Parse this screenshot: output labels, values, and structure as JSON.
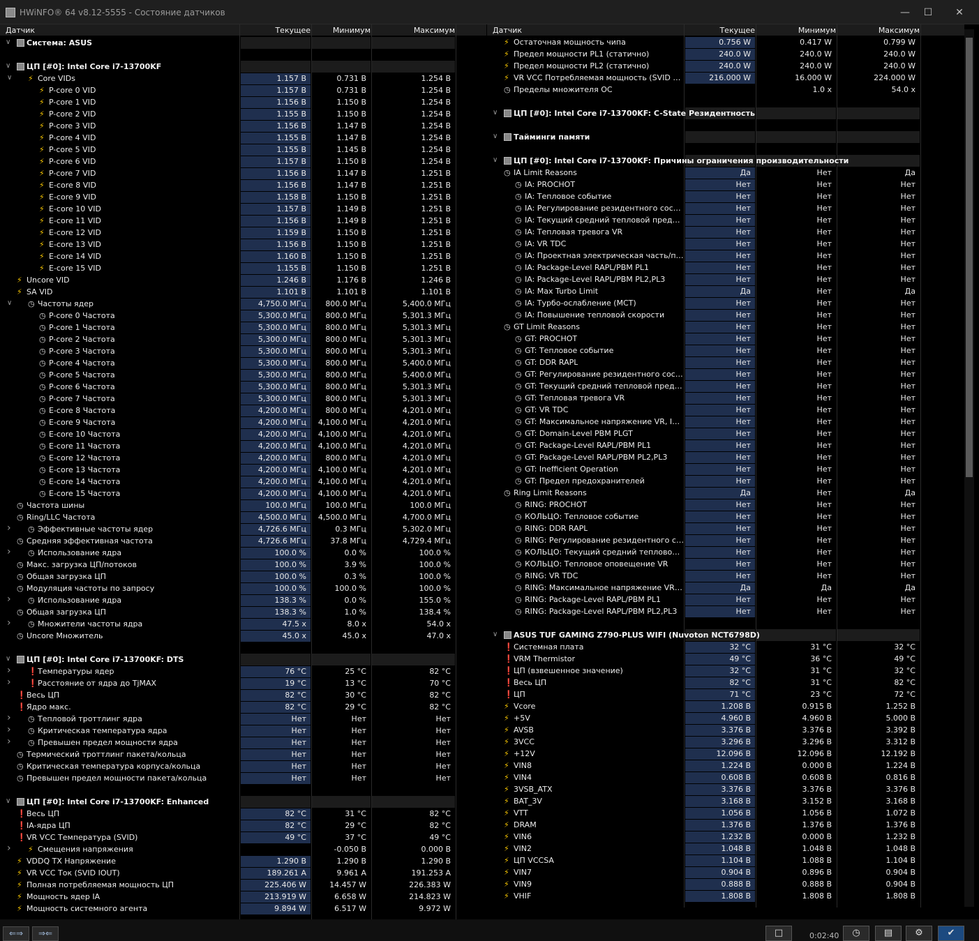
{
  "window": {
    "title": "HWiNFO® 64 v8.12-5555 - Состояние датчиков"
  },
  "columns": {
    "sensor": "Датчик",
    "current": "Текущее",
    "min": "Минимум",
    "max": "Максимум"
  },
  "statusbar": {
    "time": "0:02:40"
  },
  "left_rows": [
    [
      "s",
      "chip",
      "Система: ASUS",
      "",
      "",
      ""
    ],
    [
      "g",
      "",
      ""
    ],
    [
      "s",
      "chip",
      "ЦП [#0]: Intel Core i7-13700KF",
      "",
      "",
      ""
    ],
    [
      1,
      "bolt",
      "Core VIDs",
      "1.157 В",
      "0.731 В",
      "1.254 В",
      "e"
    ],
    [
      2,
      "bolt",
      "P-core 0 VID",
      "1.157 В",
      "0.731 В",
      "1.254 В"
    ],
    [
      2,
      "bolt",
      "P-core 1 VID",
      "1.156 В",
      "1.150 В",
      "1.254 В"
    ],
    [
      2,
      "bolt",
      "P-core 2 VID",
      "1.155 В",
      "1.150 В",
      "1.254 В"
    ],
    [
      2,
      "bolt",
      "P-core 3 VID",
      "1.156 В",
      "1.147 В",
      "1.254 В"
    ],
    [
      2,
      "bolt",
      "P-core 4 VID",
      "1.155 В",
      "1.147 В",
      "1.254 В"
    ],
    [
      2,
      "bolt",
      "P-core 5 VID",
      "1.155 В",
      "1.145 В",
      "1.254 В"
    ],
    [
      2,
      "bolt",
      "P-core 6 VID",
      "1.157 В",
      "1.150 В",
      "1.254 В"
    ],
    [
      2,
      "bolt",
      "P-core 7 VID",
      "1.156 В",
      "1.147 В",
      "1.251 В"
    ],
    [
      2,
      "bolt",
      "E-core 8 VID",
      "1.156 В",
      "1.147 В",
      "1.251 В"
    ],
    [
      2,
      "bolt",
      "E-core 9 VID",
      "1.158 В",
      "1.150 В",
      "1.251 В"
    ],
    [
      2,
      "bolt",
      "E-core 10 VID",
      "1.157 В",
      "1.149 В",
      "1.251 В"
    ],
    [
      2,
      "bolt",
      "E-core 11 VID",
      "1.156 В",
      "1.149 В",
      "1.251 В"
    ],
    [
      2,
      "bolt",
      "E-core 12 VID",
      "1.159 В",
      "1.150 В",
      "1.251 В"
    ],
    [
      2,
      "bolt",
      "E-core 13 VID",
      "1.156 В",
      "1.150 В",
      "1.251 В"
    ],
    [
      2,
      "bolt",
      "E-core 14 VID",
      "1.160 В",
      "1.150 В",
      "1.251 В"
    ],
    [
      2,
      "bolt",
      "E-core 15 VID",
      "1.155 В",
      "1.150 В",
      "1.251 В"
    ],
    [
      0,
      "bolt",
      "Uncore VID",
      "1.246 В",
      "1.176 В",
      "1.246 В"
    ],
    [
      0,
      "bolt",
      "SA VID",
      "1.101 В",
      "1.101 В",
      "1.101 В"
    ],
    [
      1,
      "clock",
      "Частоты ядер",
      "4,750.0 МГц",
      "800.0 МГц",
      "5,400.0 МГц",
      "e"
    ],
    [
      2,
      "clock",
      "P-core 0 Частота",
      "5,300.0 МГц",
      "800.0 МГц",
      "5,301.3 МГц"
    ],
    [
      2,
      "clock",
      "P-core 1 Частота",
      "5,300.0 МГц",
      "800.0 МГц",
      "5,301.3 МГц"
    ],
    [
      2,
      "clock",
      "P-core 2 Частота",
      "5,300.0 МГц",
      "800.0 МГц",
      "5,301.3 МГц"
    ],
    [
      2,
      "clock",
      "P-core 3 Частота",
      "5,300.0 МГц",
      "800.0 МГц",
      "5,301.3 МГц"
    ],
    [
      2,
      "clock",
      "P-core 4 Частота",
      "5,300.0 МГц",
      "800.0 МГц",
      "5,400.0 МГц"
    ],
    [
      2,
      "clock",
      "P-core 5 Частота",
      "5,300.0 МГц",
      "800.0 МГц",
      "5,400.0 МГц"
    ],
    [
      2,
      "clock",
      "P-core 6 Частота",
      "5,300.0 МГц",
      "800.0 МГц",
      "5,301.3 МГц"
    ],
    [
      2,
      "clock",
      "P-core 7 Частота",
      "5,300.0 МГц",
      "800.0 МГц",
      "5,301.3 МГц"
    ],
    [
      2,
      "clock",
      "E-core 8 Частота",
      "4,200.0 МГц",
      "800.0 МГц",
      "4,201.0 МГц"
    ],
    [
      2,
      "clock",
      "E-core 9 Частота",
      "4,200.0 МГц",
      "4,100.0 МГц",
      "4,201.0 МГц"
    ],
    [
      2,
      "clock",
      "E-core 10 Частота",
      "4,200.0 МГц",
      "4,100.0 МГц",
      "4,201.0 МГц"
    ],
    [
      2,
      "clock",
      "E-core 11 Частота",
      "4,200.0 МГц",
      "4,100.0 МГц",
      "4,201.0 МГц"
    ],
    [
      2,
      "clock",
      "E-core 12 Частота",
      "4,200.0 МГц",
      "800.0 МГц",
      "4,201.0 МГц"
    ],
    [
      2,
      "clock",
      "E-core 13 Частота",
      "4,200.0 МГц",
      "4,100.0 МГц",
      "4,201.0 МГц"
    ],
    [
      2,
      "clock",
      "E-core 14 Частота",
      "4,200.0 МГц",
      "4,100.0 МГц",
      "4,201.0 МГц"
    ],
    [
      2,
      "clock",
      "E-core 15 Частота",
      "4,200.0 МГц",
      "4,100.0 МГц",
      "4,201.0 МГц"
    ],
    [
      0,
      "clock",
      "Частота шины",
      "100.0 МГц",
      "100.0 МГц",
      "100.0 МГц"
    ],
    [
      0,
      "clock",
      "Ring/LLC Частота",
      "4,500.0 МГц",
      "4,500.0 МГц",
      "4,700.0 МГц"
    ],
    [
      1,
      "clock",
      "Эффективные частоты ядер",
      "4,726.6 МГц",
      "0.3 МГц",
      "5,302.0 МГц",
      "c"
    ],
    [
      0,
      "clock",
      "Средняя эффективная частота",
      "4,726.6 МГц",
      "37.8 МГц",
      "4,729.4 МГц"
    ],
    [
      1,
      "clock",
      "Использование ядра",
      "100.0 %",
      "0.0 %",
      "100.0 %",
      "c"
    ],
    [
      0,
      "clock",
      "Макс. загрузка ЦП/потоков",
      "100.0 %",
      "3.9 %",
      "100.0 %"
    ],
    [
      0,
      "clock",
      "Общая загрузка ЦП",
      "100.0 %",
      "0.3 %",
      "100.0 %"
    ],
    [
      0,
      "clock",
      "Модуляция частоты по запросу",
      "100.0 %",
      "100.0 %",
      "100.0 %"
    ],
    [
      1,
      "clock",
      "Использование ядра",
      "138.3 %",
      "0.0 %",
      "155.0 %",
      "c"
    ],
    [
      0,
      "clock",
      "Общая загрузка ЦП",
      "138.3 %",
      "1.0 %",
      "138.4 %"
    ],
    [
      1,
      "clock",
      "Множители частоты ядра",
      "47.5 x",
      "8.0 x",
      "54.0 x",
      "c"
    ],
    [
      0,
      "clock",
      "Uncore Множитель",
      "45.0 x",
      "45.0 x",
      "47.0 x"
    ],
    [
      "g",
      "",
      ""
    ],
    [
      "s",
      "chip",
      "ЦП [#0]: Intel Core i7-13700KF: DTS",
      "",
      "",
      ""
    ],
    [
      1,
      "therm",
      "Температуры ядер",
      "76 °C",
      "25 °C",
      "82 °C",
      "c"
    ],
    [
      1,
      "therm",
      "Расстояние от ядра до TjMAX",
      "19 °C",
      "13 °C",
      "70 °C",
      "c"
    ],
    [
      0,
      "therm",
      "Весь ЦП",
      "82 °C",
      "30 °C",
      "82 °C"
    ],
    [
      0,
      "therm",
      "Ядро макс.",
      "82 °C",
      "29 °C",
      "82 °C"
    ],
    [
      1,
      "clock",
      "Тепловой троттлинг ядра",
      "Нет",
      "Нет",
      "Нет",
      "c"
    ],
    [
      1,
      "clock",
      "Критическая температура ядра",
      "Нет",
      "Нет",
      "Нет",
      "c"
    ],
    [
      1,
      "clock",
      "Превышен предел мощности ядра",
      "Нет",
      "Нет",
      "Нет",
      "c"
    ],
    [
      0,
      "clock",
      "Термический троттлинг пакета/кольца",
      "Нет",
      "Нет",
      "Нет"
    ],
    [
      0,
      "clock",
      "Критическая температура корпуса/кольца",
      "Нет",
      "Нет",
      "Нет"
    ],
    [
      0,
      "clock",
      "Превышен предел мощности пакета/кольца",
      "Нет",
      "Нет",
      "Нет"
    ],
    [
      "g",
      "",
      ""
    ],
    [
      "s",
      "chip",
      "ЦП [#0]: Intel Core i7-13700KF: Enhanced",
      "",
      "",
      ""
    ],
    [
      0,
      "therm",
      "Весь ЦП",
      "82 °C",
      "31 °C",
      "82 °C"
    ],
    [
      0,
      "therm",
      "IA-ядра ЦП",
      "82 °C",
      "29 °C",
      "82 °C"
    ],
    [
      0,
      "therm",
      "VR VCC Температура (SVID)",
      "49 °C",
      "37 °C",
      "49 °C"
    ],
    [
      1,
      "bolt",
      "Смещения напряжения",
      "",
      "-0.050 В",
      "0.000 В",
      "c"
    ],
    [
      0,
      "bolt",
      "VDDQ TX Напряжение",
      "1.290 В",
      "1.290 В",
      "1.290 В"
    ],
    [
      0,
      "bolt",
      "VR VCC Ток (SVID IOUT)",
      "189.261 A",
      "9.961 A",
      "191.253 A"
    ],
    [
      0,
      "bolt",
      "Полная потребляемая мощность ЦП",
      "225.406 W",
      "14.457 W",
      "226.383 W"
    ],
    [
      0,
      "bolt",
      "Мощность ядер IA",
      "213.919 W",
      "6.658 W",
      "214.823 W"
    ],
    [
      0,
      "bolt",
      "Мощность системного агента",
      "9.894 W",
      "6.517 W",
      "9.972 W"
    ]
  ],
  "right_rows": [
    [
      0,
      "bolt",
      "Остаточная мощность чипа",
      "0.756 W",
      "0.417 W",
      "0.799 W"
    ],
    [
      0,
      "bolt",
      "Предел мощности PL1 (статично)",
      "240.0 W",
      "240.0 W",
      "240.0 W"
    ],
    [
      0,
      "bolt",
      "Предел мощности PL2 (статично)",
      "240.0 W",
      "240.0 W",
      "240.0 W"
    ],
    [
      0,
      "bolt",
      "VR VCC Потребляемая мощность (SVID POUT)",
      "216.000 W",
      "16.000 W",
      "224.000 W"
    ],
    [
      0,
      "clock",
      "Пределы множителя ОС",
      "",
      "1.0 x",
      "54.0 x",
      "c"
    ],
    [
      "g",
      "",
      ""
    ],
    [
      "s",
      "chip",
      "ЦП [#0]: Intel Core i7-13700KF: C-State Резидентность",
      "",
      "",
      ""
    ],
    [
      "g",
      "",
      ""
    ],
    [
      "s",
      "chip",
      "Тайминги памяти",
      "",
      "",
      ""
    ],
    [
      "g",
      "",
      ""
    ],
    [
      "s",
      "chip",
      "ЦП [#0]: Intel Core i7-13700KF: Причины ограничения производительности",
      "",
      "",
      ""
    ],
    [
      0,
      "clock",
      "IA Limit Reasons",
      "Да",
      "Нет",
      "Да",
      "e"
    ],
    [
      1,
      "clock",
      "IA: PROCHOT",
      "Нет",
      "Нет",
      "Нет"
    ],
    [
      1,
      "clock",
      "IA: Тепловое событие",
      "Нет",
      "Нет",
      "Нет"
    ],
    [
      1,
      "clock",
      "IA: Регулирование резидентного состоя…",
      "Нет",
      "Нет",
      "Нет"
    ],
    [
      1,
      "clock",
      "IA: Текущий средний тепловой предел (…",
      "Нет",
      "Нет",
      "Нет"
    ],
    [
      1,
      "clock",
      "IA: Тепловая тревога VR",
      "Нет",
      "Нет",
      "Нет"
    ],
    [
      1,
      "clock",
      "IA: VR TDC",
      "Нет",
      "Нет",
      "Нет"
    ],
    [
      1,
      "clock",
      "IA: Проектная электрическая часть/про…",
      "Нет",
      "Нет",
      "Нет"
    ],
    [
      1,
      "clock",
      "IA: Package-Level RAPL/PBM PL1",
      "Нет",
      "Нет",
      "Нет"
    ],
    [
      1,
      "clock",
      "IA: Package-Level RAPL/PBM PL2,PL3",
      "Нет",
      "Нет",
      "Нет"
    ],
    [
      1,
      "clock",
      "IA: Max Turbo Limit",
      "Да",
      "Нет",
      "Да"
    ],
    [
      1,
      "clock",
      "IA: Турбо-ослабление (MCT)",
      "Нет",
      "Нет",
      "Нет"
    ],
    [
      1,
      "clock",
      "IA: Повышение тепловой скорости",
      "Нет",
      "Нет",
      "Нет"
    ],
    [
      0,
      "clock",
      "GT Limit Reasons",
      "Нет",
      "Нет",
      "Нет",
      "e"
    ],
    [
      1,
      "clock",
      "GT: PROCHOT",
      "Нет",
      "Нет",
      "Нет"
    ],
    [
      1,
      "clock",
      "GT: Тепловое событие",
      "Нет",
      "Нет",
      "Нет"
    ],
    [
      1,
      "clock",
      "GT: DDR RAPL",
      "Нет",
      "Нет",
      "Нет"
    ],
    [
      1,
      "clock",
      "GT: Регулирование резидентного состоя…",
      "Нет",
      "Нет",
      "Нет"
    ],
    [
      1,
      "clock",
      "GT: Текущий средний тепловой предел (…",
      "Нет",
      "Нет",
      "Нет"
    ],
    [
      1,
      "clock",
      "GT: Тепловая тревога VR",
      "Нет",
      "Нет",
      "Нет"
    ],
    [
      1,
      "clock",
      "GT: VR TDC",
      "Нет",
      "Нет",
      "Нет"
    ],
    [
      1,
      "clock",
      "GT: Максимальное напряжение VR, ICCm…",
      "Нет",
      "Нет",
      "Нет"
    ],
    [
      1,
      "clock",
      "GT: Domain-Level PBM PLGT",
      "Нет",
      "Нет",
      "Нет"
    ],
    [
      1,
      "clock",
      "GT: Package-Level RAPL/PBM PL1",
      "Нет",
      "Нет",
      "Нет"
    ],
    [
      1,
      "clock",
      "GT: Package-Level RAPL/PBM PL2,PL3",
      "Нет",
      "Нет",
      "Нет"
    ],
    [
      1,
      "clock",
      "GT: Inefficient Operation",
      "Нет",
      "Нет",
      "Нет"
    ],
    [
      1,
      "clock",
      "GT: Предел предохранителей",
      "Нет",
      "Нет",
      "Нет"
    ],
    [
      0,
      "clock",
      "Ring Limit Reasons",
      "Да",
      "Нет",
      "Да",
      "e"
    ],
    [
      1,
      "clock",
      "RING: PROCHOT",
      "Нет",
      "Нет",
      "Нет"
    ],
    [
      1,
      "clock",
      "КОЛЬЦО: Тепловое событие",
      "Нет",
      "Нет",
      "Нет"
    ],
    [
      1,
      "clock",
      "RING: DDR RAPL",
      "Нет",
      "Нет",
      "Нет"
    ],
    [
      1,
      "clock",
      "RING: Регулирование резидентного сост…",
      "Нет",
      "Нет",
      "Нет"
    ],
    [
      1,
      "clock",
      "КОЛЬЦО: Текущий средний тепловой пр…",
      "Нет",
      "Нет",
      "Нет"
    ],
    [
      1,
      "clock",
      "КОЛЬЦО: Тепловое оповещение VR",
      "Нет",
      "Нет",
      "Нет"
    ],
    [
      1,
      "clock",
      "RING: VR TDC",
      "Нет",
      "Нет",
      "Нет"
    ],
    [
      1,
      "clock",
      "RING: Максимальное напряжение VR, IC…",
      "Да",
      "Да",
      "Да"
    ],
    [
      1,
      "clock",
      "RING: Package-Level RAPL/PBM PL1",
      "Нет",
      "Нет",
      "Нет"
    ],
    [
      1,
      "clock",
      "RING: Package-Level RAPL/PBM PL2,PL3",
      "Нет",
      "Нет",
      "Нет"
    ],
    [
      "g",
      "",
      ""
    ],
    [
      "s",
      "chip",
      "ASUS TUF GAMING Z790-PLUS WIFI (Nuvoton NCT6798D)",
      "",
      "",
      ""
    ],
    [
      0,
      "therm",
      "Системная плата",
      "32 °C",
      "31 °C",
      "32 °C"
    ],
    [
      0,
      "therm",
      "VRM Thermistor",
      "49 °C",
      "36 °C",
      "49 °C"
    ],
    [
      0,
      "therm",
      "ЦП (взвешенное значение)",
      "32 °C",
      "31 °C",
      "32 °C"
    ],
    [
      0,
      "therm",
      "Весь ЦП",
      "82 °C",
      "31 °C",
      "82 °C"
    ],
    [
      0,
      "therm",
      "ЦП",
      "71 °C",
      "23 °C",
      "72 °C"
    ],
    [
      0,
      "bolt",
      "Vcore",
      "1.208 В",
      "0.915 В",
      "1.252 В"
    ],
    [
      0,
      "bolt",
      "+5V",
      "4.960 В",
      "4.960 В",
      "5.000 В"
    ],
    [
      0,
      "bolt",
      "AVSB",
      "3.376 В",
      "3.376 В",
      "3.392 В"
    ],
    [
      0,
      "bolt",
      "3VCC",
      "3.296 В",
      "3.296 В",
      "3.312 В"
    ],
    [
      0,
      "bolt",
      "+12V",
      "12.096 В",
      "12.096 В",
      "12.192 В"
    ],
    [
      0,
      "bolt",
      "VIN8",
      "1.224 В",
      "0.000 В",
      "1.224 В"
    ],
    [
      0,
      "bolt",
      "VIN4",
      "0.608 В",
      "0.608 В",
      "0.816 В"
    ],
    [
      0,
      "bolt",
      "3VSB_ATX",
      "3.376 В",
      "3.376 В",
      "3.376 В"
    ],
    [
      0,
      "bolt",
      "BAT_3V",
      "3.168 В",
      "3.152 В",
      "3.168 В"
    ],
    [
      0,
      "bolt",
      "VTT",
      "1.056 В",
      "1.056 В",
      "1.072 В"
    ],
    [
      0,
      "bolt",
      "DRAM",
      "1.376 В",
      "1.376 В",
      "1.376 В"
    ],
    [
      0,
      "bolt",
      "VIN6",
      "1.232 В",
      "0.000 В",
      "1.232 В"
    ],
    [
      0,
      "bolt",
      "VIN2",
      "1.048 В",
      "1.048 В",
      "1.048 В"
    ],
    [
      0,
      "bolt",
      "ЦП VCCSA",
      "1.104 В",
      "1.088 В",
      "1.104 В"
    ],
    [
      0,
      "bolt",
      "VIN7",
      "0.904 В",
      "0.896 В",
      "0.904 В"
    ],
    [
      0,
      "bolt",
      "VIN9",
      "0.888 В",
      "0.888 В",
      "0.904 В"
    ],
    [
      0,
      "bolt",
      "VHIF",
      "1.808 В",
      "1.808 В",
      "1.808 В"
    ]
  ]
}
